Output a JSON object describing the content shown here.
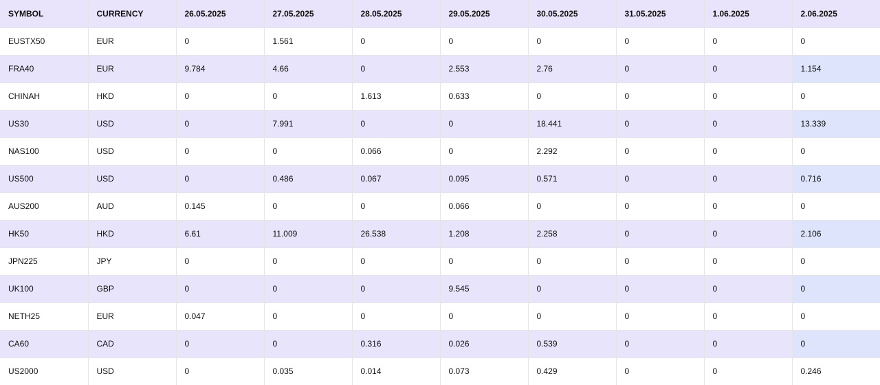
{
  "table": {
    "headers": [
      "SYMBOL",
      "CURRENCY",
      "26.05.2025",
      "27.05.2025",
      "28.05.2025",
      "29.05.2025",
      "30.05.2025",
      "31.05.2025",
      "1.06.2025",
      "2.06.2025"
    ],
    "rows": [
      [
        "EUSTX50",
        "EUR",
        "0",
        "1.561",
        "0",
        "0",
        "0",
        "0",
        "0",
        "0"
      ],
      [
        "FRA40",
        "EUR",
        "9.784",
        "4.66",
        "0",
        "2.553",
        "2.76",
        "0",
        "0",
        "1.154"
      ],
      [
        "CHINAH",
        "HKD",
        "0",
        "0",
        "1.613",
        "0.633",
        "0",
        "0",
        "0",
        "0"
      ],
      [
        "US30",
        "USD",
        "0",
        "7.991",
        "0",
        "0",
        "18.441",
        "0",
        "0",
        "13.339"
      ],
      [
        "NAS100",
        "USD",
        "0",
        "0",
        "0.066",
        "0",
        "2.292",
        "0",
        "0",
        "0"
      ],
      [
        "US500",
        "USD",
        "0",
        "0.486",
        "0.067",
        "0.095",
        "0.571",
        "0",
        "0",
        "0.716"
      ],
      [
        "AUS200",
        "AUD",
        "0.145",
        "0",
        "0",
        "0.066",
        "0",
        "0",
        "0",
        "0"
      ],
      [
        "HK50",
        "HKD",
        "6.61",
        "11.009",
        "26.538",
        "1.208",
        "2.258",
        "0",
        "0",
        "2.106"
      ],
      [
        "JPN225",
        "JPY",
        "0",
        "0",
        "0",
        "0",
        "0",
        "0",
        "0",
        "0"
      ],
      [
        "UK100",
        "GBP",
        "0",
        "0",
        "0",
        "9.545",
        "0",
        "0",
        "0",
        "0"
      ],
      [
        "NETH25",
        "EUR",
        "0.047",
        "0",
        "0",
        "0",
        "0",
        "0",
        "0",
        "0"
      ],
      [
        "CA60",
        "CAD",
        "0",
        "0",
        "0.316",
        "0.026",
        "0.539",
        "0",
        "0",
        "0"
      ],
      [
        "US2000",
        "USD",
        "0",
        "0.035",
        "0.014",
        "0.073",
        "0.429",
        "0",
        "0",
        "0.246"
      ]
    ]
  },
  "colors": {
    "header_bg": "#e9e4fc",
    "stripe_bg": "#e7e4fb",
    "stripe_last_col_bg": "#dde4fb",
    "row_bg": "#ffffff",
    "border": "#e4e4ea"
  }
}
